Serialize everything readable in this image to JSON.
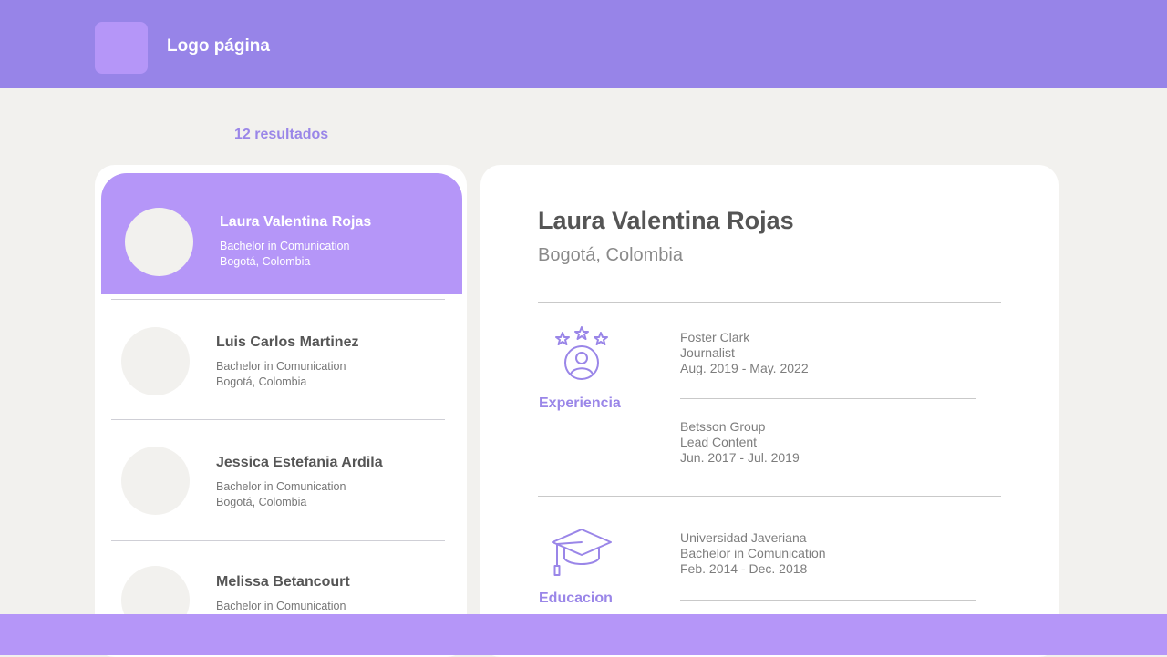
{
  "header": {
    "logo_text": "Logo página"
  },
  "results": {
    "count_label": "12 resultados"
  },
  "candidates": [
    {
      "name": "Laura Valentina Rojas",
      "degree": "Bachelor in Comunication",
      "city": "Bogotá, Colombia",
      "selected": true
    },
    {
      "name": "Luis Carlos Martinez",
      "degree": "Bachelor in Comunication",
      "city": "Bogotá, Colombia"
    },
    {
      "name": "Jessica Estefania Ardila",
      "degree": "Bachelor in Comunication",
      "city": "Bogotá, Colombia"
    },
    {
      "name": "Melissa Betancourt",
      "degree": "Bachelor in Comunication",
      "city": ""
    }
  ],
  "detail": {
    "name": "Laura Valentina Rojas",
    "city": "Bogotá, Colombia",
    "experience": {
      "label": "Experiencia",
      "icon": "stars-user-icon",
      "entries": [
        {
          "org": "Foster Clark",
          "role": "Journalist",
          "period": "Aug. 2019 - May. 2022"
        },
        {
          "org": "Betsson Group",
          "role": "Lead Content",
          "period": "Jun. 2017 - Jul. 2019"
        }
      ]
    },
    "education": {
      "label": "Educacion",
      "icon": "graduation-cap-icon",
      "entries": [
        {
          "org": "Universidad Javeriana",
          "role": "Bachelor in Comunication",
          "period": "Feb. 2014 - Dec. 2018"
        }
      ]
    }
  },
  "colors": {
    "header": "#9784e8",
    "accent": "#b596f8",
    "label": "#9a86e8",
    "background": "#f2f1ee"
  }
}
